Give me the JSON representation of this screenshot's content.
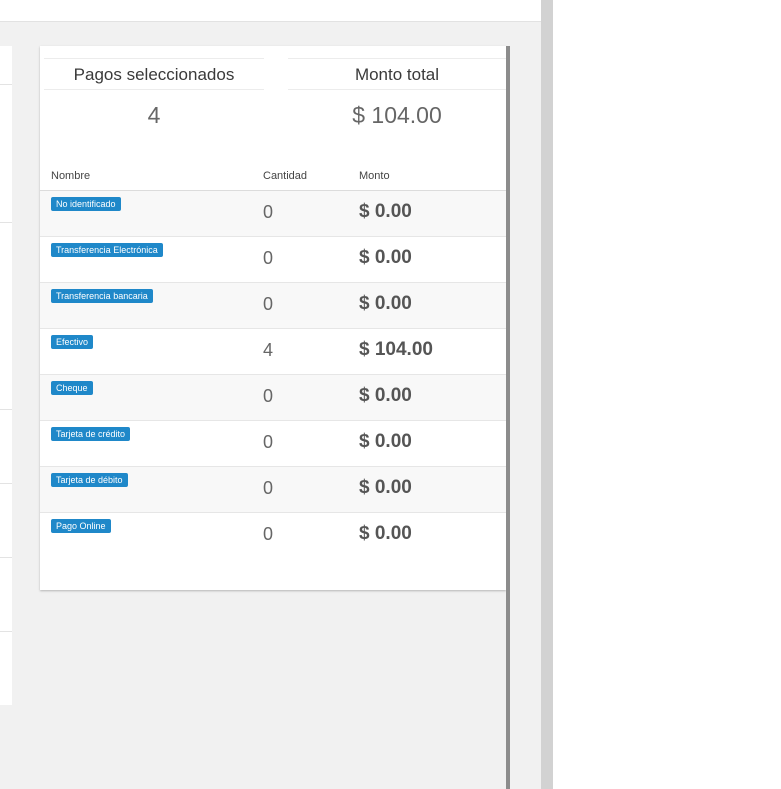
{
  "summary": {
    "selected_label": "Pagos seleccionados",
    "selected_value": "4",
    "total_label": "Monto total",
    "total_value": "$ 104.00"
  },
  "table": {
    "headers": {
      "name": "Nombre",
      "quantity": "Cantidad",
      "amount": "Monto"
    },
    "rows": [
      {
        "name": "No identificado",
        "quantity": "0",
        "amount": "$ 0.00"
      },
      {
        "name": "Transferencia Electrónica",
        "quantity": "0",
        "amount": "$ 0.00"
      },
      {
        "name": "Transferencia bancaria",
        "quantity": "0",
        "amount": "$ 0.00"
      },
      {
        "name": "Efectivo",
        "quantity": "4",
        "amount": "$ 104.00"
      },
      {
        "name": "Cheque",
        "quantity": "0",
        "amount": "$ 0.00"
      },
      {
        "name": "Tarjeta de crédito",
        "quantity": "0",
        "amount": "$ 0.00"
      },
      {
        "name": "Tarjeta de débito",
        "quantity": "0",
        "amount": "$ 0.00"
      },
      {
        "name": "Pago Online",
        "quantity": "0",
        "amount": "$ 0.00"
      }
    ]
  },
  "colors": {
    "badge": "#1f88c9",
    "background": "#f1f1f1"
  }
}
